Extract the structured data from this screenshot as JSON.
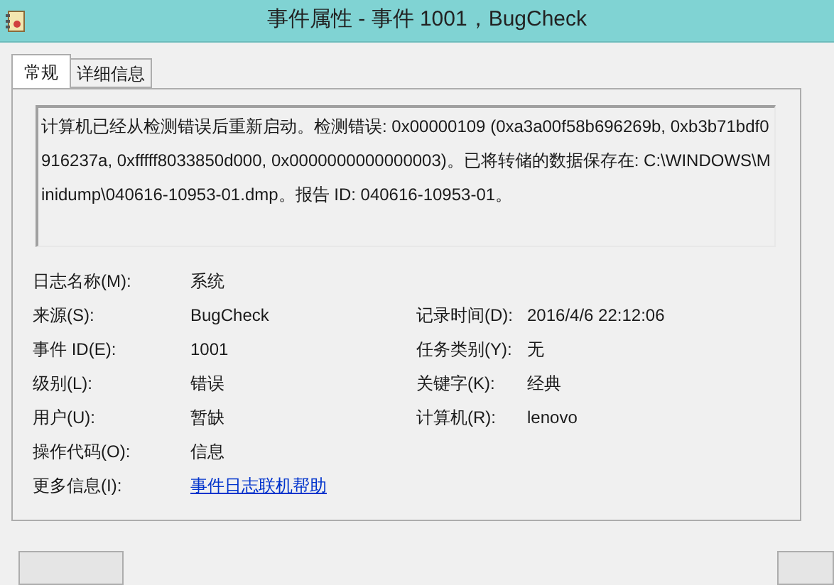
{
  "window": {
    "title": "事件属性 - 事件 1001，BugCheck"
  },
  "tabs": [
    {
      "label": "常规",
      "selected": true
    },
    {
      "label": "详细信息",
      "selected": false
    }
  ],
  "message": "计算机已经从检测错误后重新启动。检测错误: 0x00000109 (0xa3a00f58b696269b, 0xb3b71bdf0916237a, 0xfffff8033850d000, 0x0000000000000003)。已将转储的数据保存在: C:\\WINDOWS\\Minidump\\040616-10953-01.dmp。报告 ID: 040616-10953-01。",
  "fields": [
    {
      "label": "日志名称(M):",
      "value": "系统"
    },
    {
      "label": "来源(S):",
      "value": "BugCheck",
      "right_label": "记录时间(D):",
      "right_value": "2016/4/6 22:12:06"
    },
    {
      "label": "事件 ID(E):",
      "value": "1001",
      "right_label": "任务类别(Y):",
      "right_value": "无"
    },
    {
      "label": "级别(L):",
      "value": "错误",
      "right_label": "关键字(K):",
      "right_value": "经典"
    },
    {
      "label": "用户(U):",
      "value": "暂缺",
      "right_label": "计算机(R):",
      "right_value": "lenovo"
    },
    {
      "label": "操作代码(O):",
      "value": "信息"
    },
    {
      "label": "更多信息(I):",
      "value": "事件日志联机帮助",
      "kind": "link"
    }
  ]
}
